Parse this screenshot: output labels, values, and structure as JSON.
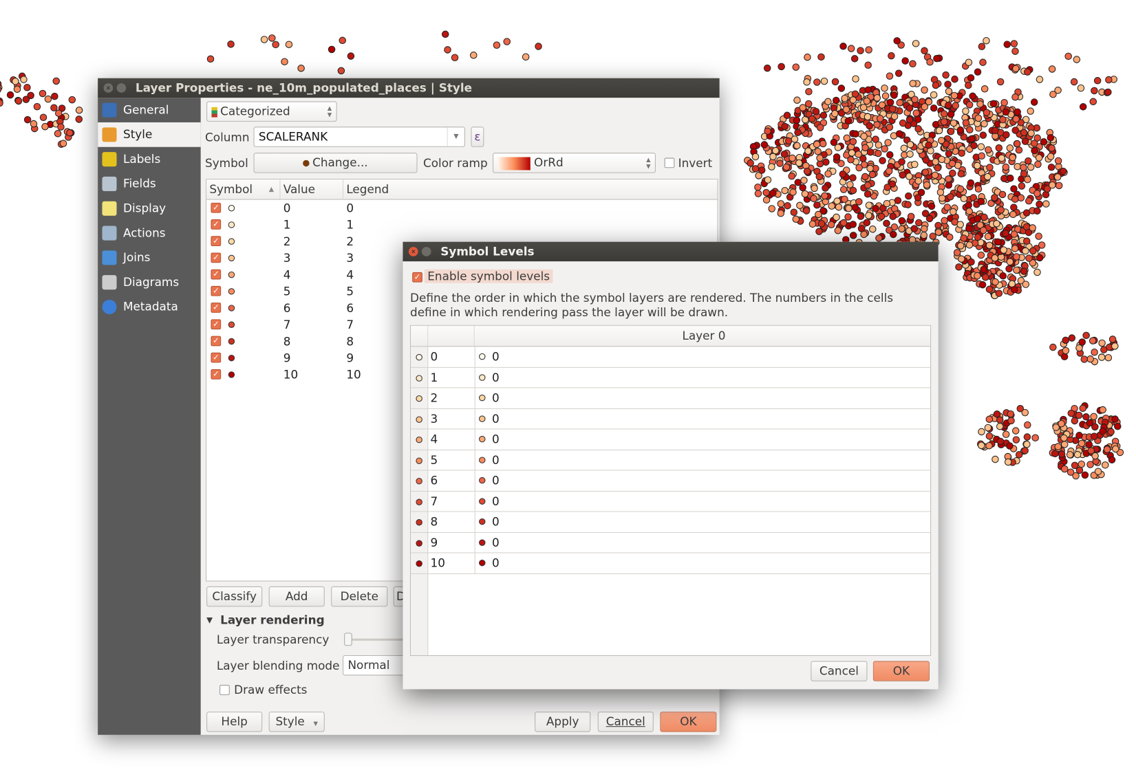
{
  "colors": [
    "#fff7ec",
    "#fee8c8",
    "#fdd8a6",
    "#fdc48e",
    "#fca976",
    "#f98b5c",
    "#ef6548",
    "#e04a33",
    "#d0301f",
    "#bb1410",
    "#b30000"
  ],
  "main_window": {
    "title": "Layer Properties - ne_10m_populated_places | Style",
    "sidebar": [
      {
        "label": "General",
        "icon": "wrench-screwdriver-icon"
      },
      {
        "label": "Style",
        "icon": "paintbrush-icon",
        "selected": true
      },
      {
        "label": "Labels",
        "icon": "abc-label-icon"
      },
      {
        "label": "Fields",
        "icon": "table-fields-icon"
      },
      {
        "label": "Display",
        "icon": "speech-bubble-icon"
      },
      {
        "label": "Actions",
        "icon": "gear-icon"
      },
      {
        "label": "Joins",
        "icon": "join-arrow-icon"
      },
      {
        "label": "Diagrams",
        "icon": "chart-icon"
      },
      {
        "label": "Metadata",
        "icon": "info-icon"
      }
    ],
    "renderer": "Categorized",
    "column_label": "Column",
    "column_value": "SCALERANK",
    "expression_button": "ε",
    "symbol_label": "Symbol",
    "change_button": "Change...",
    "color_ramp_label": "Color ramp",
    "color_ramp_value": "OrRd",
    "invert_label": "Invert",
    "table_headers": [
      "Symbol",
      "Value",
      "Legend"
    ],
    "rows": [
      {
        "value": "0",
        "legend": "0"
      },
      {
        "value": "1",
        "legend": "1"
      },
      {
        "value": "2",
        "legend": "2"
      },
      {
        "value": "3",
        "legend": "3"
      },
      {
        "value": "4",
        "legend": "4"
      },
      {
        "value": "5",
        "legend": "5"
      },
      {
        "value": "6",
        "legend": "6"
      },
      {
        "value": "7",
        "legend": "7"
      },
      {
        "value": "8",
        "legend": "8"
      },
      {
        "value": "9",
        "legend": "9"
      },
      {
        "value": "10",
        "legend": "10"
      }
    ],
    "classify": "Classify",
    "add": "Add",
    "delete": "Delete",
    "delete_all_partial": "D",
    "layer_rendering": "Layer rendering",
    "transparency_label": "Layer transparency",
    "transparency_value": 0,
    "blending_label": "Layer blending mode",
    "blending_value": "Normal",
    "draw_effects": "Draw effects",
    "help": "Help",
    "style": "Style",
    "apply": "Apply",
    "cancel": "Cancel",
    "ok": "OK"
  },
  "symbol_levels": {
    "title": "Symbol Levels",
    "enable_label": "Enable symbol levels",
    "description": "Define the order in which the symbol layers are rendered. The numbers in the cells define in which rendering pass the layer will be drawn.",
    "layer_header": "Layer 0",
    "rows": [
      {
        "label": "0",
        "level": "0"
      },
      {
        "label": "1",
        "level": "0"
      },
      {
        "label": "2",
        "level": "0"
      },
      {
        "label": "3",
        "level": "0"
      },
      {
        "label": "4",
        "level": "0"
      },
      {
        "label": "5",
        "level": "0"
      },
      {
        "label": "6",
        "level": "0"
      },
      {
        "label": "7",
        "level": "0"
      },
      {
        "label": "8",
        "level": "0"
      },
      {
        "label": "9",
        "level": "0"
      },
      {
        "label": "10",
        "level": "0"
      }
    ],
    "cancel": "Cancel",
    "ok": "OK"
  }
}
